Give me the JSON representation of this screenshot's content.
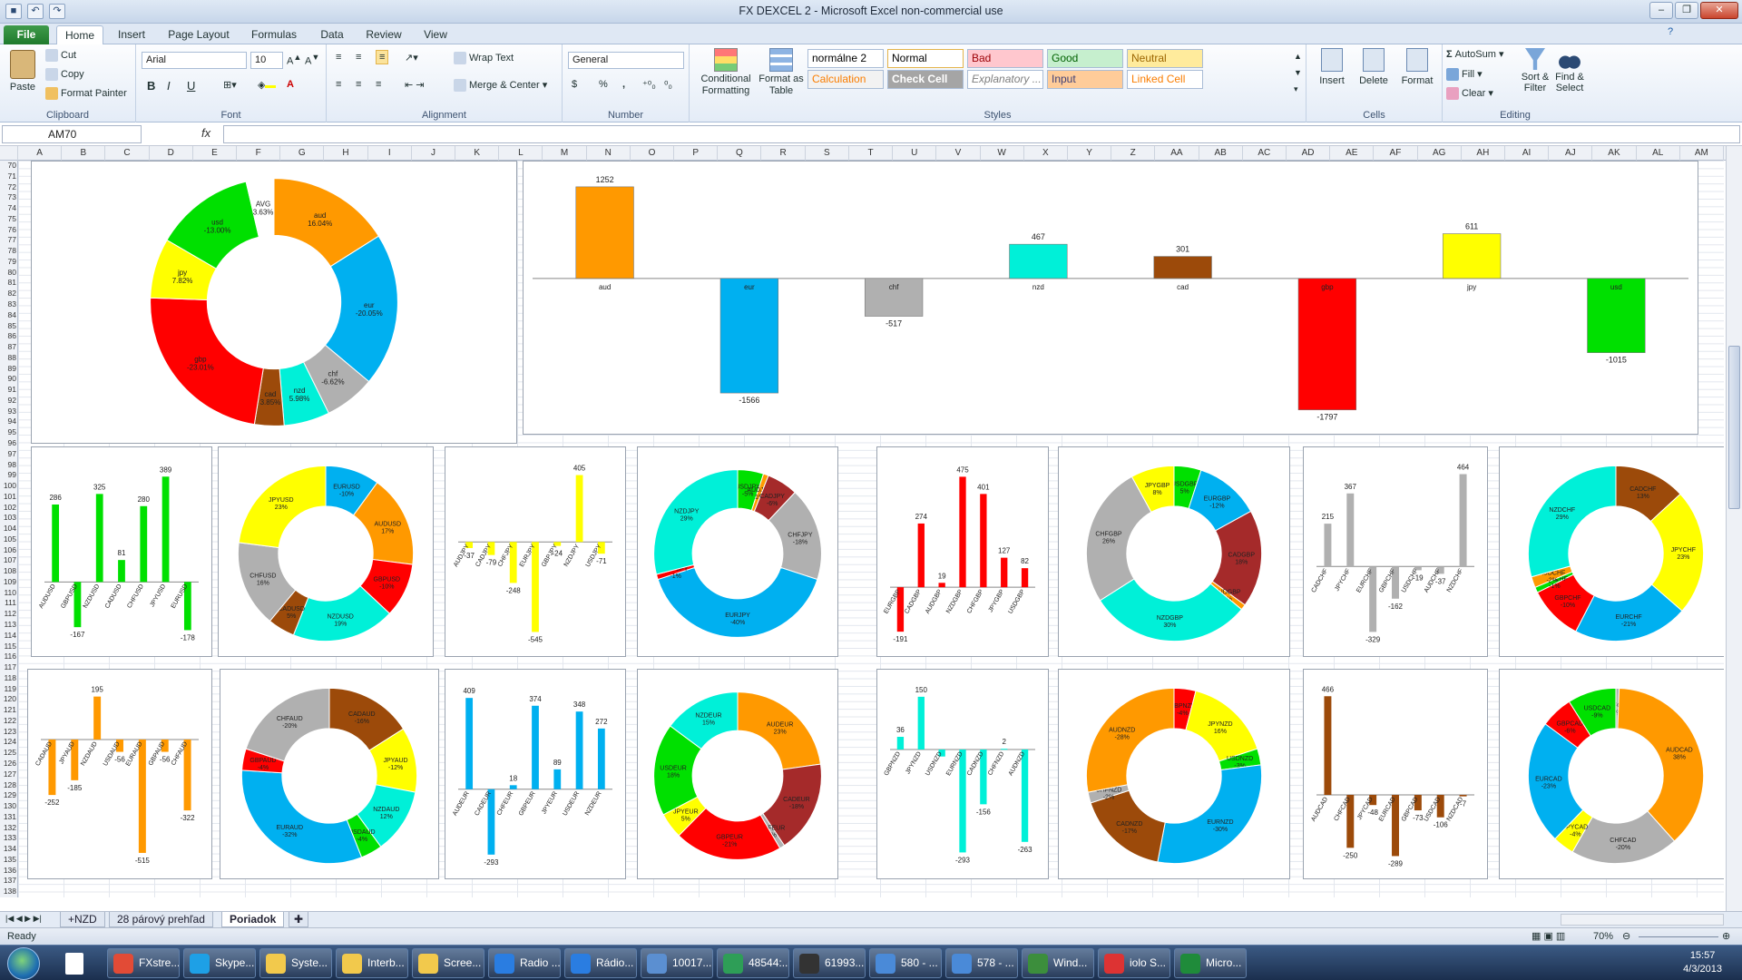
{
  "window": {
    "title": "FX DEXCEL 2  -  Microsoft Excel non-commercial use",
    "qat": [
      "save",
      "undo",
      "redo"
    ],
    "ctrl": [
      "–",
      "❐",
      "✕"
    ]
  },
  "tabs": [
    "File",
    "Home",
    "Insert",
    "Page Layout",
    "Formulas",
    "Data",
    "Review",
    "View"
  ],
  "ribbon": {
    "clipboard": {
      "label": "Clipboard",
      "paste": "Paste",
      "cut": "Cut",
      "copy": "Copy",
      "format_painter": "Format Painter"
    },
    "font": {
      "label": "Font",
      "name": "Arial",
      "size": "10",
      "bold": "B",
      "italic": "I",
      "underline": "U"
    },
    "alignment": {
      "label": "Alignment",
      "wrap": "Wrap Text",
      "merge": "Merge & Center"
    },
    "number": {
      "label": "Number",
      "format": "General",
      "dollar": "$",
      "percent": "%",
      "comma": ","
    },
    "styles": {
      "label": "Styles",
      "cond": "Conditional Formatting",
      "table": "Format as Table",
      "cells": [
        {
          "t": "normálne 2",
          "bg": "#ffffff",
          "fg": "#000000"
        },
        {
          "t": "Normal",
          "bg": "#ffffff",
          "fg": "#000000"
        },
        {
          "t": "Bad",
          "bg": "#ffc7ce",
          "fg": "#9c0006"
        },
        {
          "t": "Good",
          "bg": "#c6efce",
          "fg": "#006100"
        },
        {
          "t": "Neutral",
          "bg": "#ffeb9c",
          "fg": "#9c6500"
        },
        {
          "t": "Calculation",
          "bg": "#f2f2f2",
          "fg": "#fa7d00"
        },
        {
          "t": "Check Cell",
          "bg": "#a5a5a5",
          "fg": "#ffffff"
        },
        {
          "t": "Explanatory ...",
          "bg": "#ffffff",
          "fg": "#7f7f7f"
        },
        {
          "t": "Input",
          "bg": "#ffcc99",
          "fg": "#3f3f76"
        },
        {
          "t": "Linked Cell",
          "bg": "#ffffff",
          "fg": "#fa7d00"
        }
      ]
    },
    "cells": {
      "label": "Cells",
      "insert": "Insert",
      "delete": "Delete",
      "format": "Format"
    },
    "editing": {
      "label": "Editing",
      "autosum": "AutoSum",
      "fill": "Fill",
      "clear": "Clear",
      "sort": "Sort & Filter",
      "find": "Find & Select"
    }
  },
  "formula": {
    "namebox": "AM70",
    "fx": "fx",
    "value": ""
  },
  "columns": [
    "A",
    "B",
    "C",
    "D",
    "E",
    "F",
    "G",
    "H",
    "I",
    "J",
    "K",
    "L",
    "M",
    "N",
    "O",
    "P",
    "Q",
    "R",
    "S",
    "T",
    "U",
    "V",
    "W",
    "X",
    "Y",
    "Z",
    "AA",
    "AB",
    "AC",
    "AD",
    "AE",
    "AF",
    "AG",
    "AH",
    "AI",
    "AJ",
    "AK",
    "AL",
    "AM"
  ],
  "rows": {
    "first": 70,
    "last": 138
  },
  "colors": {
    "aud": "#ff9900",
    "eur": "#00b0f0",
    "chf": "#b0b0b0",
    "nzd": "#00f0d8",
    "cad": "#9c4a0a",
    "gbp": "#ff0000",
    "jpy": "#ffff00",
    "usd": "#00e000",
    "avg": "#ffffff",
    "cadgbp": "#a52a2a"
  },
  "chart_data": [
    {
      "type": "pie",
      "title": "",
      "slices": [
        {
          "label": "aud",
          "pct": "16.04%",
          "value": 16.04,
          "color": "aud"
        },
        {
          "label": "eur",
          "pct": "-20.05%",
          "value": 20.05,
          "color": "eur"
        },
        {
          "label": "chf",
          "pct": "-6.62%",
          "value": 6.62,
          "color": "chf"
        },
        {
          "label": "nzd",
          "pct": "5.98%",
          "value": 5.98,
          "color": "nzd"
        },
        {
          "label": "cad",
          "pct": "3.85%",
          "value": 3.85,
          "color": "cad"
        },
        {
          "label": "gbp",
          "pct": "-23.01%",
          "value": 23.01,
          "color": "gbp"
        },
        {
          "label": "jpy",
          "pct": "7.82%",
          "value": 7.82,
          "color": "jpy"
        },
        {
          "label": "usd",
          "pct": "-13.00%",
          "value": 13.0,
          "color": "usd"
        },
        {
          "label": "AVG",
          "pct": "3.63%",
          "value": 3.63,
          "color": "avg"
        }
      ]
    },
    {
      "type": "bar",
      "categories": [
        "aud",
        "eur",
        "chf",
        "nzd",
        "cad",
        "gbp",
        "jpy",
        "usd"
      ],
      "values": [
        1252,
        -1566,
        -517,
        467,
        301,
        -1797,
        611,
        -1015
      ],
      "colors": [
        "aud",
        "eur",
        "chf",
        "nzd",
        "cad",
        "gbp",
        "jpy",
        "usd"
      ],
      "ylim": [
        -1850,
        1300
      ]
    },
    {
      "type": "bar",
      "categories": [
        "AUDUSD",
        "GBPUSD",
        "NZDUSD",
        "CADUSD",
        "CHFUSD",
        "JPYUSD",
        "EURUSD"
      ],
      "values": [
        286,
        -167,
        325,
        81,
        280,
        389,
        -178
      ],
      "color": "usd",
      "ylim": [
        -200,
        410
      ]
    },
    {
      "type": "pie",
      "slices": [
        {
          "label": "EURUSD",
          "pct": "-10%",
          "value": 10,
          "color": "eur"
        },
        {
          "label": "AUDUSD",
          "pct": "17%",
          "value": 17,
          "color": "aud"
        },
        {
          "label": "GBPUSD",
          "pct": "-10%",
          "value": 10,
          "color": "gbp"
        },
        {
          "label": "NZDUSD",
          "pct": "19%",
          "value": 19,
          "color": "nzd"
        },
        {
          "label": "CADUSD",
          "pct": "5%",
          "value": 5,
          "color": "cad"
        },
        {
          "label": "CHFUSD",
          "pct": "16%",
          "value": 16,
          "color": "chf"
        },
        {
          "label": "JPYUSD",
          "pct": "23%",
          "value": 23,
          "color": "jpy"
        }
      ]
    },
    {
      "type": "bar",
      "categories": [
        "AUDJPY",
        "CADJPY",
        "CHFJPY",
        "EURJPY",
        "GBPJPY",
        "NZDJPY",
        "USDJPY"
      ],
      "values": [
        -37,
        -79,
        -248,
        -545,
        -24,
        405,
        -71
      ],
      "labels": [
        "-37",
        "-79",
        "-248",
        "-545",
        "-24",
        "405",
        "-71"
      ],
      "color": "jpy",
      "ylim": [
        -570,
        430
      ]
    },
    {
      "type": "pie",
      "slices": [
        {
          "label": "USDJPY",
          "pct": "-5%",
          "value": 5,
          "color": "usd"
        },
        {
          "label": "AUDJPY",
          "pct": "1%",
          "value": 1,
          "color": "aud"
        },
        {
          "label": "CADJPY",
          "pct": "-6%",
          "value": 6,
          "color": "cadgbp"
        },
        {
          "label": "CHFJPY",
          "pct": "-18%",
          "value": 18,
          "color": "chf"
        },
        {
          "label": "EURJPY",
          "pct": "-40%",
          "value": 40,
          "color": "eur"
        },
        {
          "label": "GBPJPY",
          "pct": "-1%",
          "value": 1,
          "color": "gbp"
        },
        {
          "label": "NZDJPY",
          "pct": "29%",
          "value": 29,
          "color": "nzd"
        }
      ]
    },
    {
      "type": "bar",
      "categories": [
        "EURGBP",
        "CADGBP",
        "AUDGBP",
        "NZDGBP",
        "CHFGBP",
        "JPYGBP",
        "USDGBP"
      ],
      "values": [
        -191,
        274,
        19,
        475,
        401,
        127,
        82
      ],
      "color": "gbp",
      "ylim": [
        -210,
        500
      ]
    },
    {
      "type": "pie",
      "slices": [
        {
          "label": "USDGBP",
          "pct": "5%",
          "value": 5,
          "color": "usd"
        },
        {
          "label": "EURGBP",
          "pct": "-12%",
          "value": 12,
          "color": "eur"
        },
        {
          "label": "CADGBP",
          "pct": "18%",
          "value": 18,
          "color": "cadgbp"
        },
        {
          "label": "AUDGBP",
          "pct": "1%",
          "value": 1,
          "color": "aud"
        },
        {
          "label": "NZDGBP",
          "pct": "30%",
          "value": 30,
          "color": "nzd"
        },
        {
          "label": "CHFGBP",
          "pct": "26%",
          "value": 26,
          "color": "chf"
        },
        {
          "label": "JPYGBP",
          "pct": "8%",
          "value": 8,
          "color": "jpy"
        }
      ]
    },
    {
      "type": "bar",
      "categories": [
        "CADCHF",
        "JPYCHF",
        "EURCHF",
        "GBPCHF",
        "USDCHF",
        "AUDCHF",
        "NZDCHF"
      ],
      "values": [
        215,
        367,
        -329,
        -162,
        -19,
        -37,
        464
      ],
      "color": "chf",
      "ylim": [
        -350,
        480
      ]
    },
    {
      "type": "pie",
      "slices": [
        {
          "label": "CADCHF",
          "pct": "13%",
          "value": 13,
          "color": "cad"
        },
        {
          "label": "JPYCHF",
          "pct": "23%",
          "value": 23,
          "color": "jpy"
        },
        {
          "label": "EURCHF",
          "pct": "-21%",
          "value": 21,
          "color": "eur"
        },
        {
          "label": "GBPCHF",
          "pct": "-10%",
          "value": 10,
          "color": "gbp"
        },
        {
          "label": "USDCHF",
          "pct": "-1%",
          "value": 1,
          "color": "usd"
        },
        {
          "label": "AUDCHF",
          "pct": "-2%",
          "value": 2,
          "color": "aud"
        },
        {
          "label": "NZDCHF",
          "pct": "29%",
          "value": 29,
          "color": "nzd"
        }
      ]
    },
    {
      "type": "bar",
      "categories": [
        "CADAUD",
        "JPYAUD",
        "NZDAUD",
        "USDAUD",
        "EURAUD",
        "GBPAUD",
        "CHFAUD"
      ],
      "values": [
        -252,
        -185,
        195,
        -56,
        -515,
        -56,
        -322
      ],
      "color": "aud",
      "ylim": [
        -540,
        210
      ]
    },
    {
      "type": "pie",
      "slices": [
        {
          "label": "CADAUD",
          "pct": "-16%",
          "value": 16,
          "color": "cad"
        },
        {
          "label": "JPYAUD",
          "pct": "-12%",
          "value": 12,
          "color": "jpy"
        },
        {
          "label": "NZDAUD",
          "pct": "12%",
          "value": 12,
          "color": "nzd"
        },
        {
          "label": "USDAUD",
          "pct": "-4%",
          "value": 4,
          "color": "usd"
        },
        {
          "label": "EURAUD",
          "pct": "-32%",
          "value": 32,
          "color": "eur"
        },
        {
          "label": "GBPAUD",
          "pct": "-4%",
          "value": 4,
          "color": "gbp"
        },
        {
          "label": "CHFAUD",
          "pct": "-20%",
          "value": 20,
          "color": "chf"
        }
      ]
    },
    {
      "type": "bar",
      "categories": [
        "AUDEUR",
        "CADEUR",
        "CHFEUR",
        "GBPEUR",
        "JPYEUR",
        "USDEUR",
        "NZDEUR"
      ],
      "values": [
        409,
        -293,
        18,
        374,
        89,
        348,
        272
      ],
      "color": "eur",
      "ylim": [
        -310,
        430
      ]
    },
    {
      "type": "pie",
      "slices": [
        {
          "label": "AUDEUR",
          "pct": "23%",
          "value": 23,
          "color": "aud"
        },
        {
          "label": "CADEUR",
          "pct": "-18%",
          "value": 18,
          "color": "cadgbp"
        },
        {
          "label": "CHFEUR",
          "pct": "1%",
          "value": 1,
          "color": "chf"
        },
        {
          "label": "GBPEUR",
          "pct": "-21%",
          "value": 21,
          "color": "gbp"
        },
        {
          "label": "JPYEUR",
          "pct": "5%",
          "value": 5,
          "color": "jpy"
        },
        {
          "label": "USDEUR",
          "pct": "18%",
          "value": 18,
          "color": "usd"
        },
        {
          "label": "NZDEUR",
          "pct": "15%",
          "value": 15,
          "color": "nzd"
        }
      ]
    },
    {
      "type": "bar",
      "categories": [
        "GBPNZD",
        "JPYNZD",
        "USDNZD",
        "EURNZD",
        "CADNZD",
        "CHFNZD",
        "AUDNZD"
      ],
      "values": [
        36,
        150,
        -20,
        -293,
        -156,
        2,
        -263
      ],
      "labels": [
        "36",
        "150",
        "",
        "-293",
        "-156",
        "2",
        "-263"
      ],
      "color": "nzd",
      "ylim": [
        -310,
        160
      ]
    },
    {
      "type": "pie",
      "slices": [
        {
          "label": "GBPNZD",
          "pct": "-4%",
          "value": 4,
          "color": "gbp"
        },
        {
          "label": "JPYNZD",
          "pct": "16%",
          "value": 16,
          "color": "jpy"
        },
        {
          "label": "USDNZD",
          "pct": "-3%",
          "value": 3,
          "color": "usd"
        },
        {
          "label": "EURNZD",
          "pct": "-30%",
          "value": 30,
          "color": "eur"
        },
        {
          "label": "CADNZD",
          "pct": "-17%",
          "value": 17,
          "color": "cad"
        },
        {
          "label": "CHFNZD",
          "pct": "-2%",
          "value": 2,
          "color": "chf"
        },
        {
          "label": "AUDNZD",
          "pct": "-28%",
          "value": 28,
          "color": "aud"
        }
      ]
    },
    {
      "type": "bar",
      "categories": [
        "AUDCAD",
        "CHFCAD",
        "JPYCAD",
        "EURCAD",
        "GBPCAD",
        "USDCAD",
        "NZDCAD"
      ],
      "values": [
        466,
        -250,
        -48,
        -289,
        -73,
        -106,
        -7
      ],
      "labels": [
        "466",
        "-250",
        "-48",
        "-289",
        "-73",
        "-106",
        "-7"
      ],
      "color": "cad",
      "ylim": [
        -300,
        480
      ]
    },
    {
      "type": "pie",
      "slices": [
        {
          "label": "CHFCAD",
          "pct": "0%",
          "value": 0.6,
          "color": "chf"
        },
        {
          "label": "AUDCAD",
          "pct": "38%",
          "value": 38,
          "color": "aud"
        },
        {
          "label": "CHFCAD",
          "pct": "-20%",
          "value": 20,
          "color": "chf"
        },
        {
          "label": "JPYCAD",
          "pct": "-4%",
          "value": 4,
          "color": "jpy"
        },
        {
          "label": "EURCAD",
          "pct": "-23%",
          "value": 23,
          "color": "eur"
        },
        {
          "label": "GBPCAD",
          "pct": "-6%",
          "value": 6,
          "color": "gbp"
        },
        {
          "label": "USDCAD",
          "pct": "-9%",
          "value": 9,
          "color": "usd"
        }
      ]
    }
  ],
  "sheets": [
    "+NZD",
    "28 párový prehľad",
    "Poriadok"
  ],
  "status": {
    "ready": "Ready",
    "zoom": "70%"
  },
  "taskbar": {
    "items": [
      "FXstre...",
      "Skype...",
      "Syste...",
      "Interb...",
      "Scree...",
      "Radio ...",
      "Rádio...",
      "10017...",
      "48544:...",
      "61993...",
      "580 - ...",
      "578 - ...",
      "Wind...",
      "iolo S...",
      "Micro..."
    ],
    "time": "15:57",
    "date": "4/3/2013"
  }
}
